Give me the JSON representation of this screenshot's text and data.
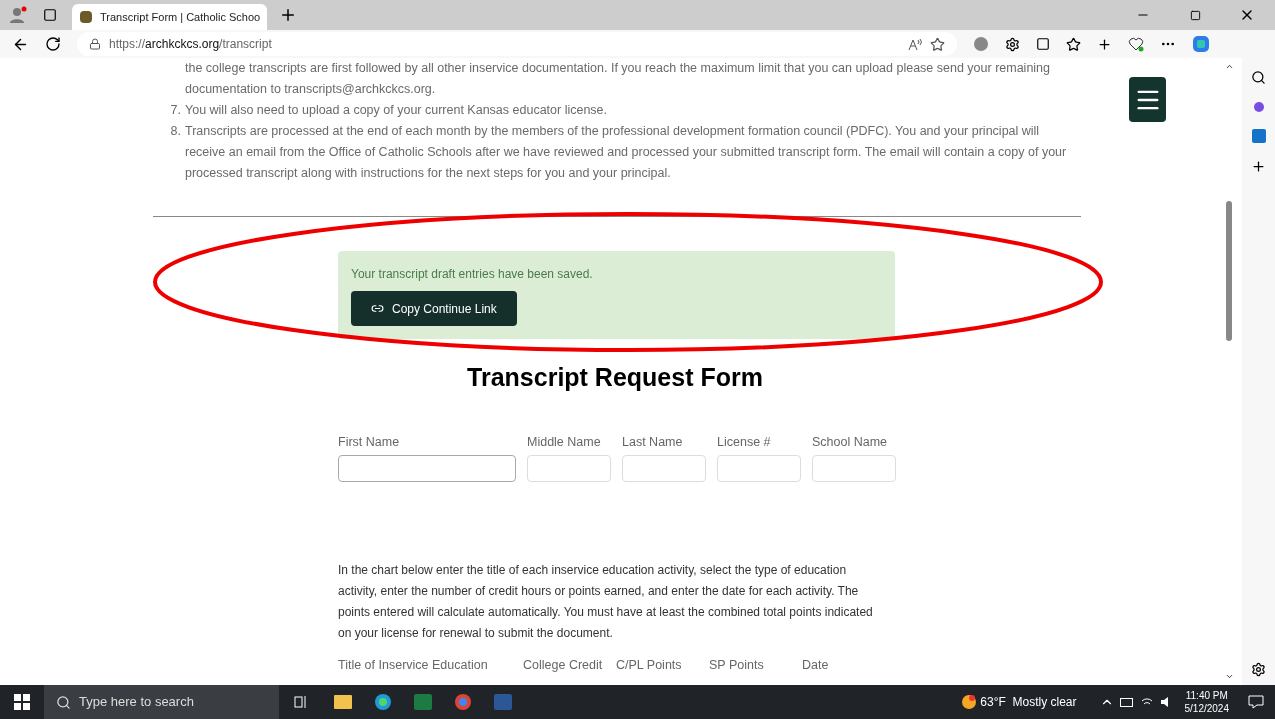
{
  "browser": {
    "tab_title": "Transcript Form | Catholic Schoo",
    "url_scheme": "https://",
    "url_host": "archkckcs.org",
    "url_path": "/transcript"
  },
  "page": {
    "continued_lines": [
      "the college transcripts are first followed by all other inservice documentation.  If you reach the maximum limit that you can upload please send your remaining",
      "documentation to transcripts@archkckcs.org."
    ],
    "items": [
      {
        "number": "7.",
        "text": "You will also need to upload a copy of your current Kansas educator license."
      },
      {
        "number": "8.",
        "text": "Transcripts are  processed at the end of each month by the members of the professional development formation council (PDFC).  You and your principal will receive an email from the Office of Catholic Schools after we have reviewed and processed your submitted transcript form.  The email will contain a copy of your processed transcript along with instructions for the next steps for you and your principal."
      }
    ],
    "alert": {
      "message": "Your transcript draft entries have been saved.",
      "button": "Copy Continue Link"
    },
    "form_title": "Transcript Request Form",
    "fields": [
      {
        "label": "First Name",
        "wide": true
      },
      {
        "label": "Middle Name",
        "wide": false
      },
      {
        "label": "Last Name",
        "wide": false
      },
      {
        "label": "License #",
        "wide": false
      },
      {
        "label": "School Name",
        "wide": false
      }
    ],
    "intro": "In the chart below enter the title of each inservice education activity, select the type of education activity, enter the number of credit hours or points earned, and enter the date for each activity.  The points entered will calculate automatically. You must have at least the combined total points indicated on your license for renewal to submit the document.",
    "columns": [
      "Title of Inservice Education",
      "College Credit",
      "C/PL Points",
      "SP Points",
      "Date"
    ]
  },
  "taskbar": {
    "search_placeholder": "Type here to search",
    "weather": "63°F  Mostly clear",
    "time": "11:40 PM",
    "date": "5/12/2024"
  }
}
